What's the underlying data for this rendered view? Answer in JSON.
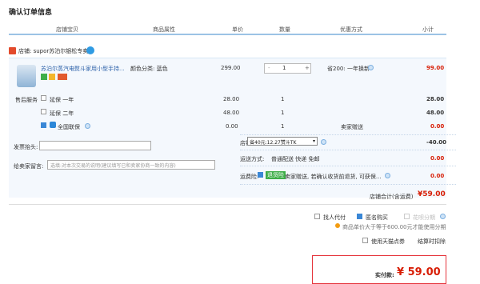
{
  "page_title": "确认订单信息",
  "columns": [
    "店铺宝贝",
    "商品属性",
    "单价",
    "数量",
    "优惠方式",
    "小计"
  ],
  "shop": {
    "label": "店铺: supor苏泊尔银松专卖"
  },
  "item": {
    "name": "苏泊尔蒸汽电熨斗家用小型手持...",
    "attr": "颜色分类: 蓝色",
    "price": "299.00",
    "qty": "1",
    "minus": "-",
    "plus": "+",
    "discount": "省200: 一年换新",
    "subtotal": "99.00"
  },
  "service": {
    "label": "售后服务",
    "rows": [
      {
        "name": "延保 一年",
        "price": "28.00",
        "qty": "1",
        "note": "",
        "subtotal": "28.00",
        "checked": false
      },
      {
        "name": "延保 二年",
        "price": "48.00",
        "qty": "1",
        "note": "",
        "subtotal": "48.00",
        "checked": false
      },
      {
        "name": "全国联保",
        "price": "0.00",
        "qty": "1",
        "note": "卖家赠送",
        "subtotal": "0.00",
        "checked": true
      }
    ]
  },
  "invoice": {
    "label": "发票抬头:",
    "value": ""
  },
  "message": {
    "label": "给卖家留言:",
    "placeholder": "选填:对本次交易的说明(建议填写已和卖家协商一致的内容)"
  },
  "shop_discount": {
    "label": "店铺优惠:",
    "value": "省40元:12.27赞斗TK",
    "amount": "-40.00"
  },
  "shipping": {
    "label": "运送方式:",
    "value": "普通配送 快递 免邮",
    "amount": "0.00"
  },
  "insurance": {
    "label": "运费险:",
    "tag": "退货险",
    "text": "卖家赠送, 若确认收货前退货, 可获保...",
    "amount": "0.00"
  },
  "shop_total": {
    "label": "店铺合计(含运费)",
    "value": "¥59.00"
  },
  "options": {
    "proxy": "找人代付",
    "anonymous": "匿名购买",
    "huabei": "花呗分期",
    "note": "商品单价大于等于600.00元才能使用分期"
  },
  "tmall_points": "使用天猫点券",
  "settle_note": "结算时扣除",
  "final": {
    "label": "实付款:",
    "value": "¥ 59.00"
  },
  "colors": {
    "accent": "#d81e06",
    "border": "#9cc3e5",
    "bg": "#f4f8fd"
  }
}
